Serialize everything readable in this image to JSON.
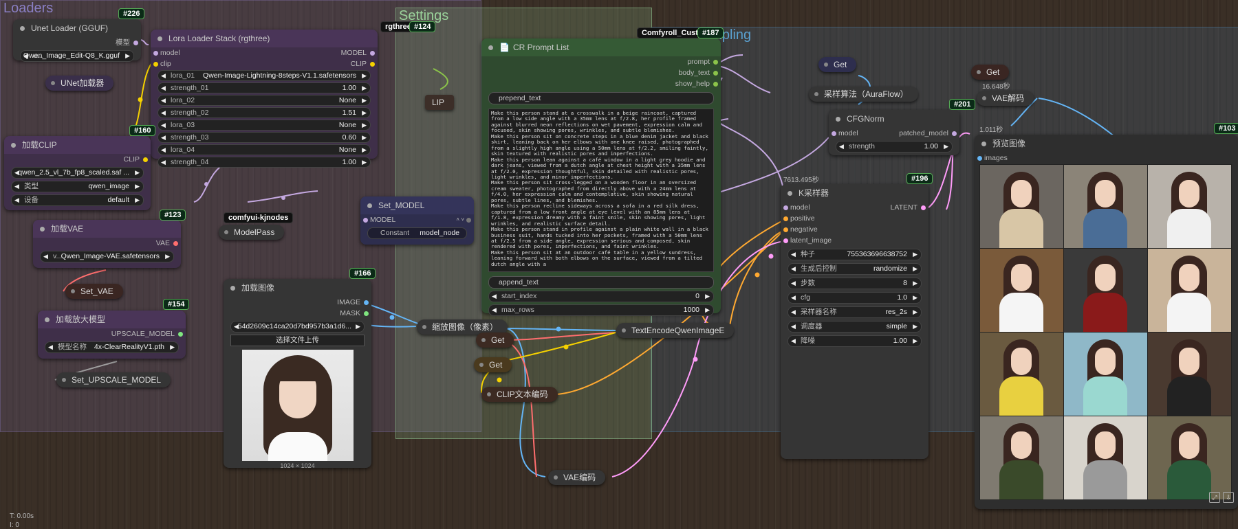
{
  "groups": {
    "loaders": "Loaders",
    "settings": "Settings",
    "qwen": "Qwen Sampling"
  },
  "colors": {
    "wire_clip": "#f5d100",
    "wire_model": "#c4a8e0",
    "wire_image": "#64b5f6",
    "wire_latent": "#ff9cf9",
    "wire_cond": "#ffa931",
    "wire_vae": "#ff6e6e",
    "wire_upscale": "#9e9e9e",
    "wire_text": "#8bc34a"
  },
  "unet": {
    "id": "#226",
    "title": "Unet Loader (GGUF)",
    "out": "模型",
    "w_label": "u...",
    "w_value": "Qwen_Image_Edit-Q8_K.gguf"
  },
  "unet_note": "UNet加载器",
  "lora": {
    "id": "#124",
    "tag": "rgthree-",
    "title": "Lora Loader Stack (rgthree)",
    "in_model": "model",
    "in_clip": "clip",
    "out_model": "MODEL",
    "out_clip": "CLIP",
    "widgets": [
      {
        "l": "lora_01",
        "v": "Qwen-Image-Lightning-8steps-V1.1.safetensors"
      },
      {
        "l": "strength_01",
        "v": "1.00"
      },
      {
        "l": "lora_02",
        "v": "None"
      },
      {
        "l": "strength_02",
        "v": "1.51"
      },
      {
        "l": "lora_03",
        "v": "None"
      },
      {
        "l": "strength_03",
        "v": "0.60"
      },
      {
        "l": "lora_04",
        "v": "None"
      },
      {
        "l": "strength_04",
        "v": "1.00"
      }
    ]
  },
  "clip_partial": "LIP",
  "clip_loader": {
    "id": "#160",
    "title": "加载CLIP",
    "out": "CLIP",
    "widgets": [
      {
        "l": "",
        "v": "qwen_2.5_vl_7b_fp8_scaled.saf ..."
      },
      {
        "l": "类型",
        "v": "qwen_image"
      },
      {
        "l": "设备",
        "v": "default"
      }
    ]
  },
  "vae_loader": {
    "id": "#123",
    "title": "加载VAE",
    "out": "VAE",
    "w_label": "v...",
    "w_value": "Qwen_Image-VAE.safetensors"
  },
  "set_vae": "Set_VAE",
  "upscale_loader": {
    "id": "#154",
    "title": "加载放大模型",
    "out": "UPSCALE_MODEL",
    "w_label": "模型名称",
    "w_value": "4x-ClearRealityV1.pth"
  },
  "set_upscale": "Set_UPSCALE_MODEL",
  "kjnodes_tag": "comfyui-kjnodes",
  "modelpass": "ModelPass",
  "set_model": {
    "title": "Set_MODEL",
    "in": "MODEL",
    "w_label": "Constant",
    "w_value": "model_node"
  },
  "load_image": {
    "id": "#166",
    "title": "加载图像",
    "out_image": "IMAGE",
    "out_mask": "MASK",
    "w_value": "54d2609c14ca20d7bd957b3a1d6...",
    "upload": "选择文件上传",
    "size": "1024 × 1024"
  },
  "prompt_list": {
    "id": "#187",
    "tag": "Comfyroll_Customi",
    "title": "CR Prompt List",
    "outs": [
      "prompt",
      "body_text",
      "show_help"
    ],
    "prepend": "prepend_text",
    "append": "append_text",
    "start_index_label": "start_index",
    "start_index": "0",
    "max_rows_label": "max_rows",
    "max_rows": "1000",
    "text": "Make this person stand at a crosswalk in a beige raincoat, captured from a low side angle with a 35mm lens at f/2.8, her profile framed against blurred neon reflections on wet pavement, expression calm and focused, skin showing pores, wrinkles, and subtle blemishes.\nMake this person sit on concrete steps in a blue denim jacket and black skirt, leaning back on her elbows with one knee raised, photographed from a slightly high angle using a 50mm lens at f/2.2, smiling faintly, skin textured with realistic pores and imperfections.\nMake this person lean against a café window in a light grey hoodie and dark jeans, viewed from a dutch angle at chest height with a 35mm lens at f/2.0, expression thoughtful, skin detailed with realistic pores, light wrinkles, and minor imperfections.\nMake this person sit cross-legged on a wooden floor in an oversized cream sweater, photographed from directly above with a 24mm lens at f/4.0, her expression calm and contemplative, skin showing natural pores, subtle lines, and blemishes.\nMake this person recline sideways across a sofa in a red silk dress, captured from a low front angle at eye level with an 85mm lens at f/1.8, expression dreamy with a faint smile, skin showing pores, light wrinkles, and realistic surface detail.\nMake this person stand in profile against a plain white wall in a black business suit, hands tucked into her pockets, framed with a 50mm lens at f/2.5 from a side angle, expression serious and composed, skin rendered with pores, imperfections, and faint wrinkles.\nMake this person sit at an outdoor café table in a yellow sundress, leaning forward with both elbows on the surface, viewed from a tilted dutch angle with a"
  },
  "scale_image": "缩放图像（像素）",
  "get1": "Get",
  "get2": "Get",
  "get3": "Get",
  "get4": "Get",
  "clip_encode": "CLIP文本编码",
  "text_encode": "TextEncodeQwenImageE",
  "vae_encode": "VAE编码",
  "sampler_algo": "采样算法（AuraFlow）",
  "cfgnorm": {
    "id": "#201",
    "title": "CFGNorm",
    "in": "model",
    "out": "patched_model",
    "w_label": "strength",
    "w_value": "1.00"
  },
  "ksampler": {
    "id": "#196",
    "timer": "7613.495秒",
    "title": "K采样器",
    "inputs": [
      "model",
      "positive",
      "negative",
      "latent_image"
    ],
    "out": "LATENT",
    "widgets": [
      {
        "l": "种子",
        "v": "755363696638752"
      },
      {
        "l": "生成后控制",
        "v": "randomize"
      },
      {
        "l": "步数",
        "v": "8"
      },
      {
        "l": "cfg",
        "v": "1.0"
      },
      {
        "l": "采样器名称",
        "v": "res_2s"
      },
      {
        "l": "调度器",
        "v": "simple"
      },
      {
        "l": "降噪",
        "v": "1.00"
      }
    ]
  },
  "vae_decode": {
    "timer": "16.648秒",
    "title": "VAE解码"
  },
  "preview": {
    "id": "#103",
    "timer": "1.011秒",
    "title": "预览图像",
    "in": "images"
  },
  "status": {
    "t": "T: 0.00s",
    "i": "I: 0"
  }
}
